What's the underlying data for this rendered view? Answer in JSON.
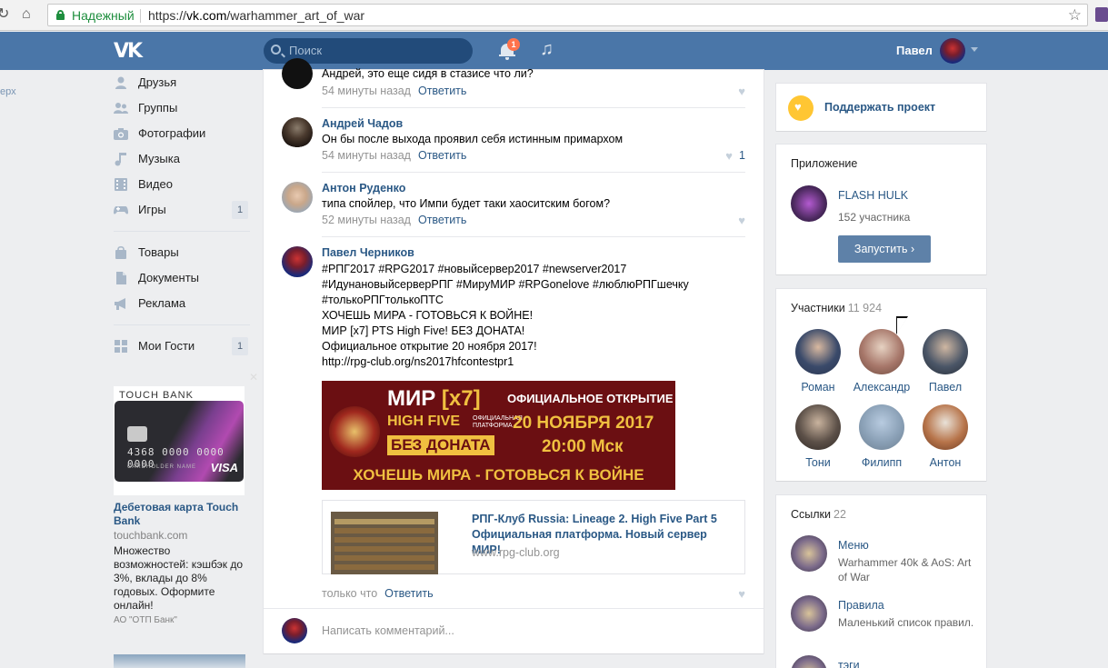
{
  "browser": {
    "secure_label": "Надежный",
    "url_scheme": "https://",
    "url_host": "vk.com",
    "url_path": "/warhammer_art_of_war"
  },
  "header": {
    "search_placeholder": "Поиск",
    "notifications_count": "1",
    "user_name": "Павел"
  },
  "left_edge_text": "ерх",
  "left_menu": {
    "items": [
      {
        "label": "Друзья",
        "icon": "friend-icon"
      },
      {
        "label": "Группы",
        "icon": "groups-icon"
      },
      {
        "label": "Фотографии",
        "icon": "camera-icon"
      },
      {
        "label": "Музыка",
        "icon": "music-icon"
      },
      {
        "label": "Видео",
        "icon": "video-icon"
      },
      {
        "label": "Игры",
        "icon": "gamepad-icon",
        "count": "1"
      }
    ],
    "items2": [
      {
        "label": "Товары",
        "icon": "bag-icon"
      },
      {
        "label": "Документы",
        "icon": "document-icon"
      },
      {
        "label": "Реклама",
        "icon": "megaphone-icon"
      }
    ],
    "items3": [
      {
        "label": "Мои Гости",
        "icon": "apps-icon",
        "count": "1"
      }
    ]
  },
  "ad": {
    "brand": "TOUCH BANK",
    "card_number": "4368 0000 0000 0000",
    "card_holder": "CARDHOLDER NAME",
    "card_network": "VISA",
    "title": "Дебетовая карта Touch Bank",
    "domain": "touchbank.com",
    "text": "Множество возможностей: кэшбэк до 3%, вклады до 8% годовых. Оформите онлайн!",
    "org": "АО \"ОТП Банк\""
  },
  "comments": [
    {
      "author": "",
      "text": "Андрей, это еще сидя в стазисе что ли?",
      "time": "54 минуты назад",
      "reply": "Ответить",
      "likes": ""
    },
    {
      "author": "Андрей Чадов",
      "text": "Он бы после выхода проявил себя истинным примархом",
      "time": "54 минуты назад",
      "reply": "Ответить",
      "likes": "1"
    },
    {
      "author": "Антон Руденко",
      "text": "типа спойлер, что Импи будет таки хаоситским богом?",
      "time": "52 минуты назад",
      "reply": "Ответить",
      "likes": ""
    }
  ],
  "post": {
    "author": "Павел Черников",
    "tags_line1": "#РПГ2017 #RPG2017 #новыйсервер2017 #newserver2017",
    "tags_line2": "#ИдунановыйсерверРПГ #МируМИР #RPGonelove #люблюРПГшечку",
    "tags_line3": "#толькоРПГтолькоПТС",
    "line1": "ХОЧЕШЬ МИРА - ГОТОВЬСЯ К ВОЙНЕ!",
    "line2": "МИР [x7] PTS High Five! БЕЗ ДОНАТА!",
    "line3": "Официальное открытие 20 ноября 2017!",
    "link": "http://rpg-club.org/ns2017hfcontestpr1",
    "banner": {
      "mir": "МИР",
      "x7": "[x7]",
      "high_five": "HIGH FIVE",
      "platform": "ОФИЦИАЛЬНАЯ ПЛАТФОРМА",
      "no_donate": "БЕЗ ДОНАТА",
      "official_opening": "ОФИЦИАЛЬНОЕ ОТКРЫТИЕ",
      "date": "20 НОЯБРЯ 2017",
      "time": "20:00 Мск",
      "slogan": "ХОЧЕШЬ МИРА - ГОТОВЬСЯ К ВОЙНЕ"
    },
    "link_card_title": "РПГ-Клуб Russia: Lineage 2. High Five Part 5 Официальная платформа. Новый сервер МИР!",
    "link_card_domain": "www.rpg-club.org",
    "time": "только что",
    "reply": "Ответить"
  },
  "composer_placeholder": "Написать комментарий...",
  "right": {
    "support_label": "Поддержать проект",
    "app_heading": "Приложение",
    "app_name": "FLASH HULK",
    "app_members": "152 участника",
    "app_button": "Запустить ›",
    "members_heading": "Участники",
    "members_count": "11 924",
    "members": [
      "Роман",
      "Александр",
      "Павел",
      "Тони",
      "Филипп",
      "Антон"
    ],
    "links_heading": "Ссылки",
    "links_count": "22",
    "links": [
      {
        "name": "Меню",
        "desc": "Warhammer 40k & AoS: Art of War"
      },
      {
        "name": "Правила",
        "desc": "Маленький список правил."
      },
      {
        "name": "тэги",
        "desc": ""
      }
    ]
  }
}
